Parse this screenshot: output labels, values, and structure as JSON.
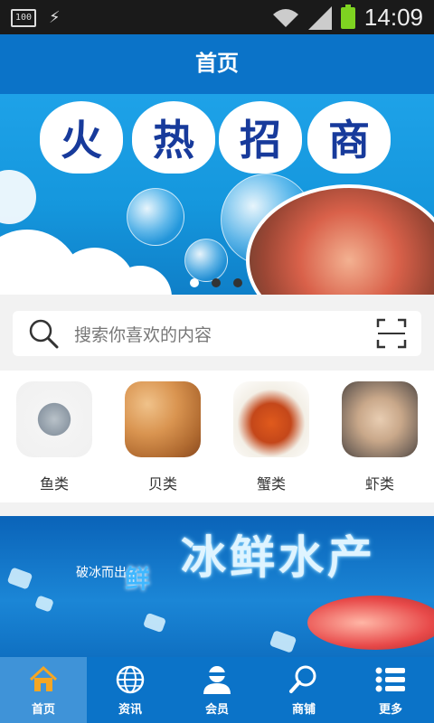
{
  "status_bar": {
    "battery_small": "100",
    "time": "14:09"
  },
  "header": {
    "title": "首页"
  },
  "banner": {
    "headline_chars": [
      "火",
      "热",
      "招",
      "商"
    ],
    "slide_count": 3,
    "active_slide": 1
  },
  "search": {
    "placeholder": "搜索你喜欢的内容"
  },
  "categories": [
    {
      "label": "鱼类",
      "icon": "fish-image"
    },
    {
      "label": "贝类",
      "icon": "shellfish-image"
    },
    {
      "label": "蟹类",
      "icon": "crab-image"
    },
    {
      "label": "虾类",
      "icon": "shrimp-image"
    }
  ],
  "promo": {
    "title": "冰鲜水产",
    "tag_small": "破冰而出",
    "tag_big": "鲜"
  },
  "tabs": [
    {
      "label": "首页",
      "icon": "home-icon",
      "active": true
    },
    {
      "label": "资讯",
      "icon": "globe-icon",
      "active": false
    },
    {
      "label": "会员",
      "icon": "user-icon",
      "active": false
    },
    {
      "label": "商铺",
      "icon": "search-icon",
      "active": false
    },
    {
      "label": "更多",
      "icon": "list-icon",
      "active": false
    }
  ],
  "colors": {
    "brand_blue": "#0b73c8",
    "active_tab": "#3f93d8",
    "status_bg": "#1a1a1a"
  }
}
